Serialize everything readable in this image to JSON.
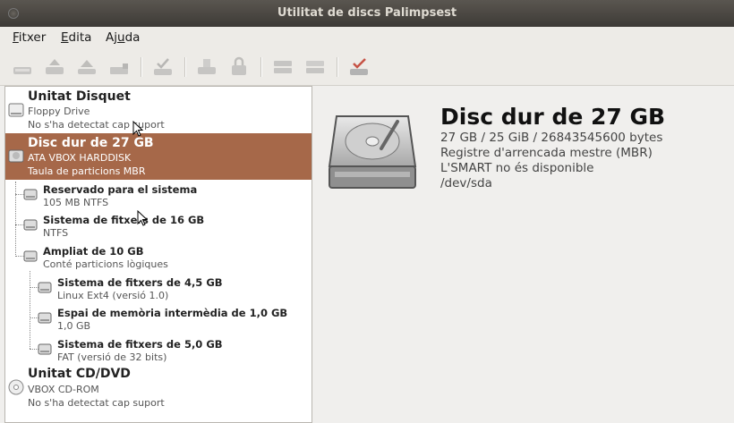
{
  "window": {
    "title": "Utilitat de discs Palimpsest"
  },
  "menu": [
    {
      "pre": "",
      "key": "F",
      "post": "itxer"
    },
    {
      "pre": "",
      "key": "E",
      "post": "dita"
    },
    {
      "pre": "Aj",
      "key": "u",
      "post": "da"
    }
  ],
  "toolbar": {
    "icons": [
      "mount-icon",
      "unmount-icon",
      "eject-icon",
      "detach-icon",
      "check-filesystem-icon",
      "format-icon",
      "lock-icon",
      "add-raid-icon",
      "create-array-icon",
      "benchmark-icon"
    ]
  },
  "sidebar": {
    "floppy": {
      "name": "Unitat Disquet",
      "model": "Floppy Drive",
      "status": "No s'ha detectat cap suport"
    },
    "hdd": {
      "name": "Disc dur de 27 GB",
      "model": "ATA VBOX HARDDISK",
      "table": "Taula de particions MBR"
    },
    "partitions": [
      {
        "name": "Reservado para el sistema",
        "detail": "105 MB NTFS"
      },
      {
        "name": "Sistema de fitxers de 16 GB",
        "detail": "NTFS"
      },
      {
        "name": "Ampliat de 10 GB",
        "detail": "Conté particions lògiques"
      }
    ],
    "logical": [
      {
        "name": "Sistema de fitxers de 4,5 GB",
        "detail": "Linux Ext4 (versió 1.0)"
      },
      {
        "name": "Espai de memòria intermèdia de 1,0 GB",
        "detail": "1,0 GB"
      },
      {
        "name": "Sistema de fitxers de 5,0 GB",
        "detail": "FAT (versió de 32 bits)"
      }
    ],
    "cdrom": {
      "name": "Unitat CD/DVD",
      "model": "VBOX CD-ROM",
      "status": "No s'ha detectat cap suport"
    }
  },
  "details": {
    "title": "Disc dur de 27 GB",
    "size": "27 GB / 25 GiB / 26843545600 bytes",
    "boot": "Registre d'arrencada mestre (MBR)",
    "smart": "L'SMART no és disponible",
    "device": "/dev/sda"
  },
  "colors": {
    "selection": "#a66849",
    "titlebar": "#3d3a36"
  }
}
